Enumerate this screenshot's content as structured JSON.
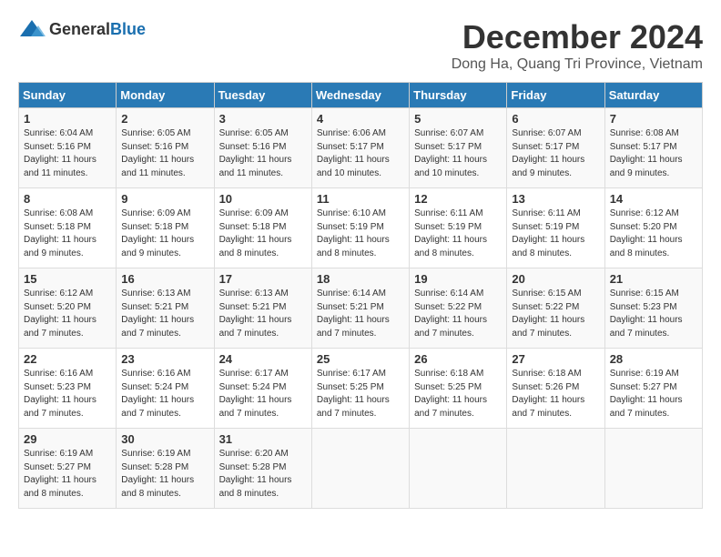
{
  "logo": {
    "general": "General",
    "blue": "Blue"
  },
  "title": "December 2024",
  "location": "Dong Ha, Quang Tri Province, Vietnam",
  "headers": [
    "Sunday",
    "Monday",
    "Tuesday",
    "Wednesday",
    "Thursday",
    "Friday",
    "Saturday"
  ],
  "weeks": [
    [
      {
        "day": "1",
        "sunrise": "6:04 AM",
        "sunset": "5:16 PM",
        "daylight": "11 hours and 11 minutes."
      },
      {
        "day": "2",
        "sunrise": "6:05 AM",
        "sunset": "5:16 PM",
        "daylight": "11 hours and 11 minutes."
      },
      {
        "day": "3",
        "sunrise": "6:05 AM",
        "sunset": "5:16 PM",
        "daylight": "11 hours and 11 minutes."
      },
      {
        "day": "4",
        "sunrise": "6:06 AM",
        "sunset": "5:17 PM",
        "daylight": "11 hours and 10 minutes."
      },
      {
        "day": "5",
        "sunrise": "6:07 AM",
        "sunset": "5:17 PM",
        "daylight": "11 hours and 10 minutes."
      },
      {
        "day": "6",
        "sunrise": "6:07 AM",
        "sunset": "5:17 PM",
        "daylight": "11 hours and 9 minutes."
      },
      {
        "day": "7",
        "sunrise": "6:08 AM",
        "sunset": "5:17 PM",
        "daylight": "11 hours and 9 minutes."
      }
    ],
    [
      {
        "day": "8",
        "sunrise": "6:08 AM",
        "sunset": "5:18 PM",
        "daylight": "11 hours and 9 minutes."
      },
      {
        "day": "9",
        "sunrise": "6:09 AM",
        "sunset": "5:18 PM",
        "daylight": "11 hours and 9 minutes."
      },
      {
        "day": "10",
        "sunrise": "6:09 AM",
        "sunset": "5:18 PM",
        "daylight": "11 hours and 8 minutes."
      },
      {
        "day": "11",
        "sunrise": "6:10 AM",
        "sunset": "5:19 PM",
        "daylight": "11 hours and 8 minutes."
      },
      {
        "day": "12",
        "sunrise": "6:11 AM",
        "sunset": "5:19 PM",
        "daylight": "11 hours and 8 minutes."
      },
      {
        "day": "13",
        "sunrise": "6:11 AM",
        "sunset": "5:19 PM",
        "daylight": "11 hours and 8 minutes."
      },
      {
        "day": "14",
        "sunrise": "6:12 AM",
        "sunset": "5:20 PM",
        "daylight": "11 hours and 8 minutes."
      }
    ],
    [
      {
        "day": "15",
        "sunrise": "6:12 AM",
        "sunset": "5:20 PM",
        "daylight": "11 hours and 7 minutes."
      },
      {
        "day": "16",
        "sunrise": "6:13 AM",
        "sunset": "5:21 PM",
        "daylight": "11 hours and 7 minutes."
      },
      {
        "day": "17",
        "sunrise": "6:13 AM",
        "sunset": "5:21 PM",
        "daylight": "11 hours and 7 minutes."
      },
      {
        "day": "18",
        "sunrise": "6:14 AM",
        "sunset": "5:21 PM",
        "daylight": "11 hours and 7 minutes."
      },
      {
        "day": "19",
        "sunrise": "6:14 AM",
        "sunset": "5:22 PM",
        "daylight": "11 hours and 7 minutes."
      },
      {
        "day": "20",
        "sunrise": "6:15 AM",
        "sunset": "5:22 PM",
        "daylight": "11 hours and 7 minutes."
      },
      {
        "day": "21",
        "sunrise": "6:15 AM",
        "sunset": "5:23 PM",
        "daylight": "11 hours and 7 minutes."
      }
    ],
    [
      {
        "day": "22",
        "sunrise": "6:16 AM",
        "sunset": "5:23 PM",
        "daylight": "11 hours and 7 minutes."
      },
      {
        "day": "23",
        "sunrise": "6:16 AM",
        "sunset": "5:24 PM",
        "daylight": "11 hours and 7 minutes."
      },
      {
        "day": "24",
        "sunrise": "6:17 AM",
        "sunset": "5:24 PM",
        "daylight": "11 hours and 7 minutes."
      },
      {
        "day": "25",
        "sunrise": "6:17 AM",
        "sunset": "5:25 PM",
        "daylight": "11 hours and 7 minutes."
      },
      {
        "day": "26",
        "sunrise": "6:18 AM",
        "sunset": "5:25 PM",
        "daylight": "11 hours and 7 minutes."
      },
      {
        "day": "27",
        "sunrise": "6:18 AM",
        "sunset": "5:26 PM",
        "daylight": "11 hours and 7 minutes."
      },
      {
        "day": "28",
        "sunrise": "6:19 AM",
        "sunset": "5:27 PM",
        "daylight": "11 hours and 7 minutes."
      }
    ],
    [
      {
        "day": "29",
        "sunrise": "6:19 AM",
        "sunset": "5:27 PM",
        "daylight": "11 hours and 8 minutes."
      },
      {
        "day": "30",
        "sunrise": "6:19 AM",
        "sunset": "5:28 PM",
        "daylight": "11 hours and 8 minutes."
      },
      {
        "day": "31",
        "sunrise": "6:20 AM",
        "sunset": "5:28 PM",
        "daylight": "11 hours and 8 minutes."
      },
      null,
      null,
      null,
      null
    ]
  ]
}
